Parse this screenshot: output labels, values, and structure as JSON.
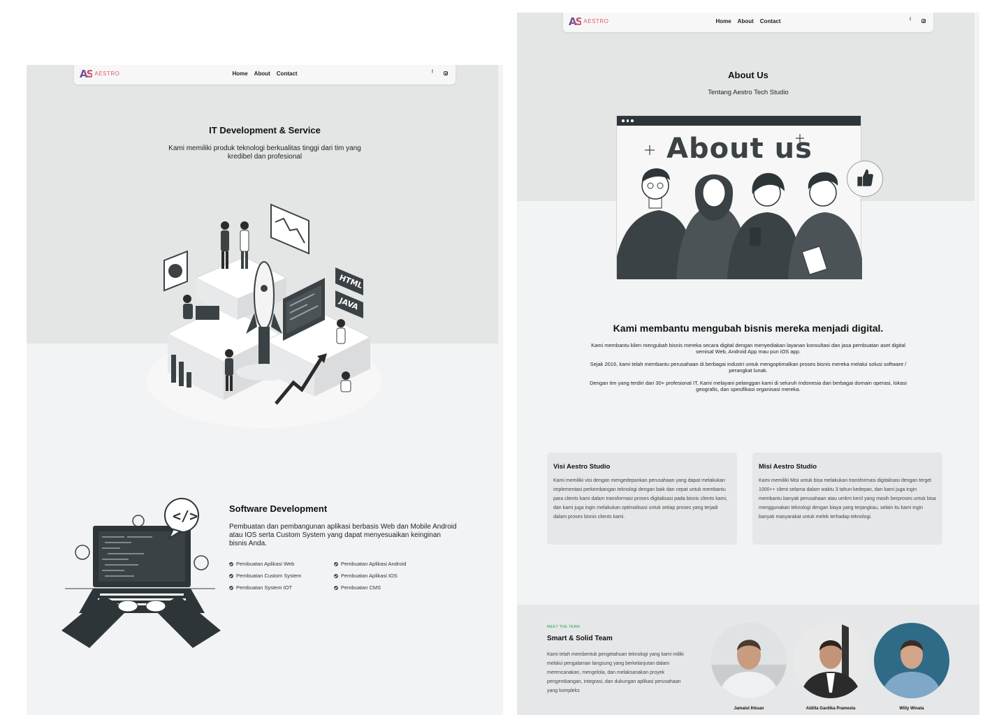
{
  "brand": {
    "logo_mark": "AS",
    "name": "AESTRO",
    "tagline": ""
  },
  "nav": {
    "home": "Home",
    "about": "About",
    "contact": "Contact",
    "facebook_icon": "f"
  },
  "left_page": {
    "hero": {
      "title": "IT Development & Service",
      "subtitle": "Kami memiliki produk teknologi berkualitas tinggi dari tim yang kredibel dan profesional"
    },
    "illustration_labels": {
      "html": "HTML",
      "java": "JAVA"
    },
    "software": {
      "title": "Software Development",
      "description": "Pembuatan dan pembangunan aplikasi berbasis Web dan Mobile Android atau IOS serta Custom System yang dapat menyesuaikan keinginan bisnis Anda.",
      "features": [
        "Pembuatan Aplikasi Web",
        "Pembuatan Aplikasi Android",
        "Pembuatan Custom System",
        "Pembuatan Aplikasi IOS",
        "Pembuatan System IOT",
        "Pembuatan CMS"
      ]
    }
  },
  "right_page": {
    "about": {
      "title": "About Us",
      "subtitle": "Tentang Aestro Tech Studio",
      "card_heading": "About us"
    },
    "mission": {
      "title": "Kami membantu mengubah bisnis mereka menjadi digital.",
      "paragraphs": [
        "Kami membantu klien mengubah bisnis mereka secara digital dengan menyediakan layanan konsultasi dan jasa pembuatan aset digital semisal Web, Android App mau pun iOS app.",
        "Sejak 2016, kami telah membantu perusahaan di berbagai industri untuk mengoptimalkan proses bisnis mereka melalui solusi software / perangkat lunak.",
        "Dengan tim yang terdiri dari 30+ profesional IT, Kami melayani pelanggan kami di seluruh Indonesia dari berbagai domain operasi, lokasi geografis, dan spesifikasi organisasi mereka."
      ]
    },
    "vision": {
      "title": "Visi Aestro Studio",
      "text": "Kami memiliki visi dengan mengedepankan perusahaan yang dapat melakukan implementasi perkembangan teknologi dengan baik dan cepat untuk membantu para clients kami dalam transformasi proses digitalisasi pada bisnis clients kami, dan kami juga ingin melakukan optimalisasi untuk setiap proses yang terjadi dalam proses bisnis clients kami."
    },
    "mission_card": {
      "title": "Misi Aestro Studio",
      "text": "Kami memiliki Misi untuk bisa melakukan transformasi digitalisasi dengan terget 1000++ client selama dalam waktu 3 tahun kedepan, dan kami juga ingin membantu banyak perusahaan atau umkm kecil yang masih berproses untuk bisa menggunakan teknologi dengan biaya yang terjangkau, selain itu kami ingin banyak masyarakat untuk melek terhadap teknologi."
    },
    "team": {
      "kicker": "MEET THE TEAM",
      "title": "Smart & Solid Team",
      "description": "Kami telah membentuk pengetahuan teknologi yang kami miliki melalui pengalaman langsung yang berkelanjutan dalam merencanakan, mengelola, dan melaksanakan proyek pengembangan, integrasi, dan dukungan aplikasi perusahaan yang kompleks",
      "members": [
        "Jamalul Ihksan",
        "Aldilla Gardika Pramesta",
        "Willy Winata"
      ]
    }
  },
  "colors": {
    "accent_green": "#2aa053",
    "brand_red": "#e05a67",
    "brand_blue": "#4a4ca8",
    "dark_gray": "#3b4245"
  }
}
